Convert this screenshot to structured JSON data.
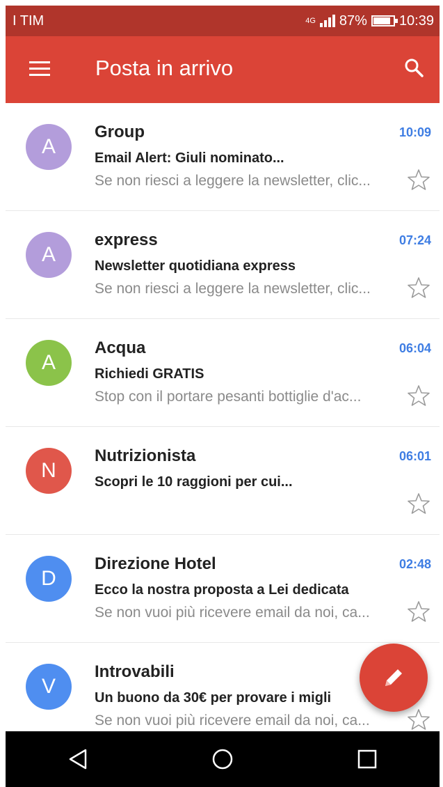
{
  "status": {
    "carrier": "I TIM",
    "network": "4G",
    "battery": "87%",
    "battery_level": 0.87,
    "time": "10:39"
  },
  "appbar": {
    "title": "Posta in arrivo"
  },
  "colors": {
    "appbar": "#db4437",
    "statusbar": "#b0352b",
    "time_accent": "#3e7de3"
  },
  "emails": [
    {
      "avatar": "A",
      "avatar_color": "#b39ddb",
      "sender": "Group",
      "time": "10:09",
      "subject": "Email Alert: Giuli nominato...",
      "snippet": "Se non riesci a leggere la newsletter, clic...",
      "starred": false
    },
    {
      "avatar": "A",
      "avatar_color": "#b39ddb",
      "sender": "express",
      "time": "07:24",
      "subject": "Newsletter quotidiana express",
      "snippet": "Se non riesci a leggere la newsletter, clic...",
      "starred": false
    },
    {
      "avatar": "A",
      "avatar_color": "#8bc34a",
      "sender": "Acqua",
      "time": "06:04",
      "subject": "Richiedi GRATIS",
      "snippet": "Stop con il portare pesanti bottiglie d'ac...",
      "starred": false
    },
    {
      "avatar": "N",
      "avatar_color": "#e0574b",
      "sender": "Nutrizionista",
      "time": "06:01",
      "subject": "Scopri le 10 raggioni per cui...",
      "snippet": "",
      "starred": false
    },
    {
      "avatar": "D",
      "avatar_color": "#4f8ef0",
      "sender": "Direzione Hotel",
      "time": "02:48",
      "subject": "Ecco la nostra proposta a Lei dedicata",
      "snippet": "Se non vuoi più ricevere email da noi, ca...",
      "starred": false
    },
    {
      "avatar": "V",
      "avatar_color": "#4f8ef0",
      "sender": "Introvabili",
      "time": "",
      "subject": "Un buono da 30€ per provare i migli",
      "snippet": "Se non vuoi più ricevere email da noi, ca...",
      "starred": false
    }
  ],
  "icons": {
    "menu": "menu-icon",
    "search": "search-icon",
    "star": "star-outline-icon",
    "compose": "pencil-icon",
    "back": "back-triangle-icon",
    "home": "home-circle-icon",
    "recents": "recents-square-icon"
  }
}
